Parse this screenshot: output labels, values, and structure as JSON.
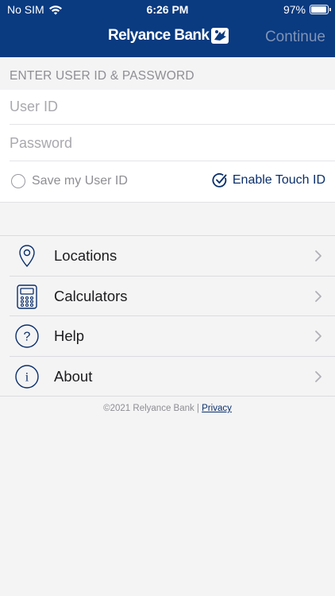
{
  "status_bar": {
    "carrier": "No SIM",
    "time": "6:26 PM",
    "battery": "97%",
    "battery_level": 0.97
  },
  "header": {
    "logo_text": "Relyance Bank",
    "continue_label": "Continue"
  },
  "login": {
    "section_title": "ENTER USER ID & PASSWORD",
    "user_id_placeholder": "User ID",
    "password_placeholder": "Password",
    "save_user_id_label": "Save my User ID",
    "enable_touch_id_label": "Enable Touch ID"
  },
  "menu": {
    "items": [
      {
        "label": "Locations",
        "icon": "location-pin-icon"
      },
      {
        "label": "Calculators",
        "icon": "calculator-icon"
      },
      {
        "label": "Help",
        "icon": "question-icon"
      },
      {
        "label": "About",
        "icon": "info-icon"
      }
    ]
  },
  "footer": {
    "copyright": "©2021 Relyance Bank |",
    "privacy_link": "Privacy"
  },
  "colors": {
    "brand_navy": "#0a3a80",
    "text_navy": "#0a2f6b",
    "muted_gray": "#8e8e93",
    "background": "#f4f4f5"
  }
}
